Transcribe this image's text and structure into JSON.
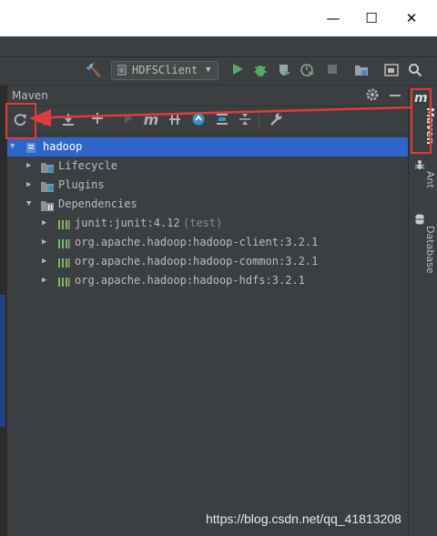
{
  "window": {
    "minimize_glyph": "—",
    "maximize_glyph": "☐",
    "close_glyph": "✕"
  },
  "toolbar": {
    "run_config": "HDFSClient",
    "dropdown_glyph": "▼"
  },
  "maven_panel": {
    "title": "Maven",
    "side_tabs": [
      "Maven",
      "Ant",
      "Database"
    ],
    "tree": {
      "root": "hadoop",
      "lifecycle": "Lifecycle",
      "plugins": "Plugins",
      "dependencies": "Dependencies",
      "deps": [
        {
          "label": "junit:junit:4.12",
          "scope": "(test)"
        },
        {
          "label": "org.apache.hadoop:hadoop-client:3.2.1",
          "scope": ""
        },
        {
          "label": "org.apache.hadoop:hadoop-common:3.2.1",
          "scope": ""
        },
        {
          "label": "org.apache.hadoop:hadoop-hdfs:3.2.1",
          "scope": ""
        }
      ]
    }
  },
  "colors": {
    "selection": "#2f65ca",
    "annotation_red": "#e23a3a",
    "run_green": "#59a869"
  },
  "watermark": "https://blog.csdn.net/qq_41813208"
}
